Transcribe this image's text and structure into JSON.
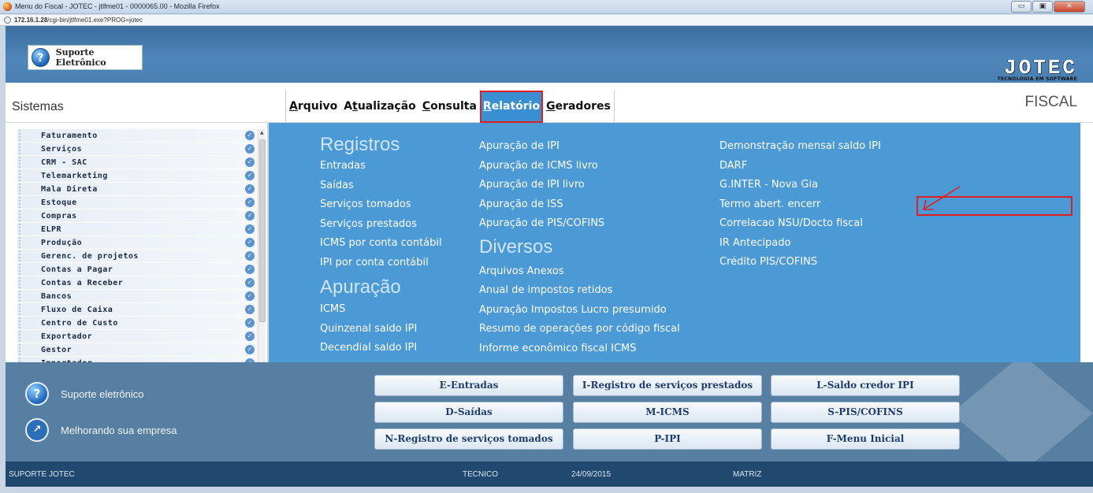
{
  "window": {
    "title": "Menu do Fiscal - JOTEC - jtlfme01 - 0000065.00 - Mozilla Firefox",
    "url_host": "172.16.1.28",
    "url_path": "/cgi-bin/jtlfme01.exe?PROG=jotec",
    "btn_minimize": "▭",
    "btn_maximize": "▣",
    "btn_close": "✕"
  },
  "header": {
    "suporte_label": "Suporte Eletrônico",
    "brand_logo": "JOTEC",
    "brand_tagline": "TECNOLOGIA EM SOFTWARE"
  },
  "menu": {
    "sistemas_label": "Sistemas",
    "module_label": "FISCAL",
    "items": [
      {
        "u": "A",
        "rest": "rquivo"
      },
      {
        "pre": "A",
        "u": "t",
        "rest": "ualização"
      },
      {
        "u": "C",
        "rest": "onsulta"
      },
      {
        "u": "R",
        "rest": "elatório"
      },
      {
        "u": "G",
        "rest": "eradores"
      }
    ]
  },
  "sidebar": {
    "items": [
      "Faturamento",
      "Serviços",
      "CRM - SAC",
      "Telemarketing",
      "Mala Direta",
      "Estoque",
      "Compras",
      "ELPR",
      "Produção",
      "Gerenc. de projetos",
      "Contas a Pagar",
      "Contas a Receber",
      "Bancos",
      "Fluxo de Caixa",
      "Centro de Custo",
      "Exportador",
      "Gestor",
      "Importador"
    ]
  },
  "panel": {
    "registros_title": "Registros",
    "registros": [
      "Entradas",
      "Saídas",
      "Serviços tomados",
      "Serviços prestados",
      "ICMS por conta contábil",
      "IPI por conta contábil"
    ],
    "apuracao_title": "Apuração",
    "apuracao": [
      "ICMS",
      "Quinzenal saldo IPI",
      "Decendial saldo IPI"
    ],
    "col2": [
      "Apuração de IPI",
      "Apuração de ICMS livro",
      "Apuração de IPI livro",
      "Apuração de ISS",
      "Apuração de PIS/COFINS"
    ],
    "diversos_title": "Diversos",
    "diversos": [
      "Arquivos Anexos",
      "Anual de impostos retidos",
      "Apuração Impostos Lucro presumido",
      "Resumo de operações por código fiscal",
      "Informe econômico fiscal ICMS"
    ],
    "col3": [
      "Demonstração mensal saldo IPI",
      "DARF",
      "G.INTER - Nova Gia",
      "Termo abert. encerr",
      "Correlacao NSU/Docto fiscal",
      "IR Antecipado",
      "Crédito PIS/COFINS"
    ]
  },
  "bottom": {
    "info1": "Suporte eletrônico",
    "info2": "Melhorando sua empresa",
    "buttons": [
      "E-Entradas",
      "I-Registro de serviços prestados",
      "L-Saldo credor IPI",
      "D-Saídas",
      "M-ICMS",
      "S-PIS/COFINS",
      "N-Registro de serviços tomados",
      "P-IPI",
      "F-Menu Inicial"
    ]
  },
  "status": {
    "left": "SUPORTE JOTEC",
    "user": "TECNICO",
    "date": "24/09/2015",
    "branch": "MATRIZ"
  },
  "colors": {
    "panel": "#4b9ad6",
    "highlight": "#e02020",
    "statusbar": "#21486e"
  }
}
